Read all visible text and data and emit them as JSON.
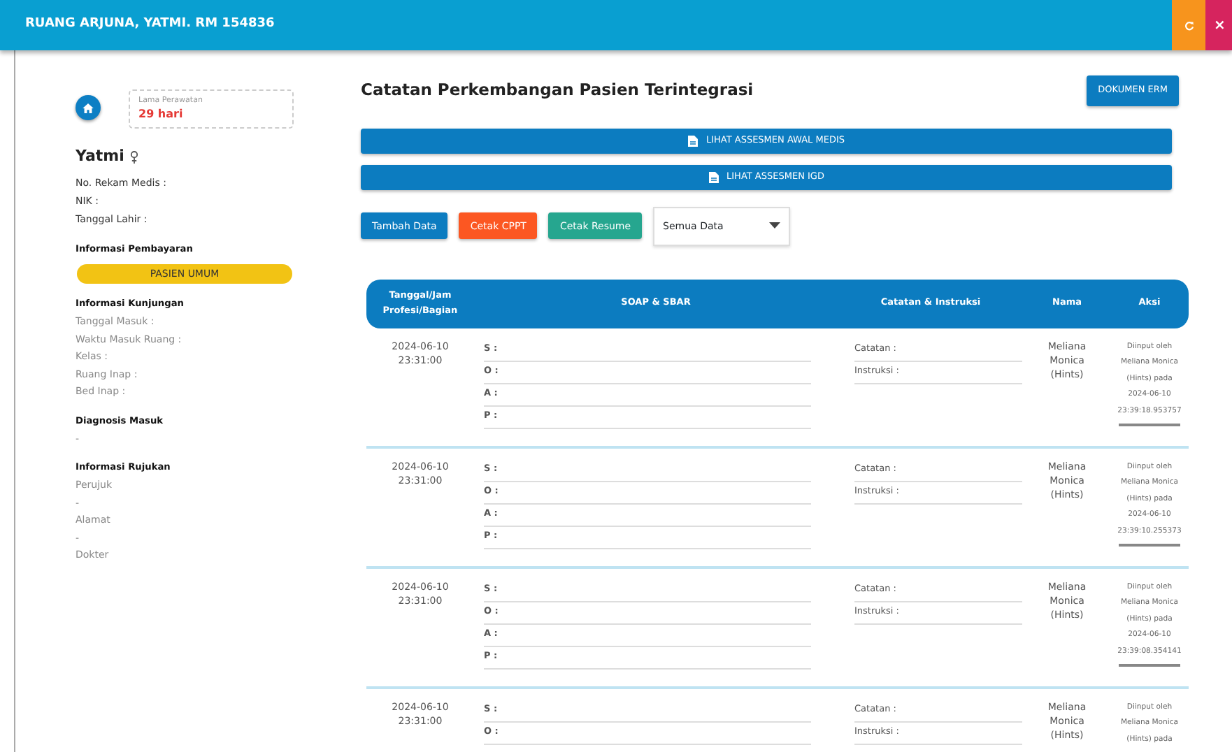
{
  "window": {
    "title": "RUANG ARJUNA, YATMI. RM 154836",
    "buttons": [
      {
        "kind": "refresh"
      },
      {
        "kind": "close",
        "label": "×"
      }
    ]
  },
  "patient": {
    "stay_label": "Lama Perawatan",
    "stay_value": "29 hari",
    "name": "Yatmi",
    "fields": [
      "No. Rekam Medis :",
      "NIK :",
      "Tanggal Lahir :"
    ],
    "sections": [
      {
        "heading": "Informasi Pembayaran",
        "badge": "PASIEN UMUM"
      },
      {
        "heading": "Informasi Kunjungan",
        "items": [
          "Tanggal Masuk :",
          "Waktu Masuk Ruang :",
          "Kelas :",
          "Ruang Inap :",
          "Bed Inap :"
        ]
      },
      {
        "heading": "Diagnosis Masuk",
        "items": [
          "-"
        ]
      },
      {
        "heading": "Informasi Rujukan",
        "items": [
          "Perujuk",
          "-",
          "Alamat",
          "-",
          "Dokter"
        ]
      }
    ]
  },
  "main": {
    "title": "Catatan Perkembangan Pasien Terintegrasi",
    "doc_button": "DOKUMEN ERM",
    "wide_buttons": [
      "LIHAT ASSESMEN AWAL MEDIS",
      "LIHAT ASSESMEN IGD"
    ],
    "actions": [
      {
        "label": "Tambah Data",
        "kind": "primary"
      },
      {
        "label": "Cetak CPPT",
        "kind": "danger"
      },
      {
        "label": "Cetak Resume",
        "kind": "success"
      }
    ],
    "filter": {
      "value": "Semua Data"
    }
  },
  "table": {
    "columns": [
      "Tanggal/Jam Profesi/Bagian",
      "SOAP & SBAR",
      "Catatan & Instruksi",
      "Nama",
      "Aksi"
    ],
    "rows": [
      {
        "date": "2024-06-10",
        "time": "23:31:00",
        "soap": [
          "S :",
          "O :",
          "A :",
          "P :"
        ],
        "notes": [
          "Catatan :",
          "Instruksi :"
        ],
        "name": "Meliana Monica (Hints)",
        "action": "Diinput oleh Meliana Monica (Hints) pada 2024-06-10 23:39:18.953757"
      },
      {
        "date": "2024-06-10",
        "time": "23:31:00",
        "soap": [
          "S :",
          "O :",
          "A :",
          "P :"
        ],
        "notes": [
          "Catatan :",
          "Instruksi :"
        ],
        "name": "Meliana Monica (Hints)",
        "action": "Diinput oleh Meliana Monica (Hints) pada 2024-06-10 23:39:10.255373"
      },
      {
        "date": "2024-06-10",
        "time": "23:31:00",
        "soap": [
          "S :",
          "O :",
          "A :",
          "P :"
        ],
        "notes": [
          "Catatan :",
          "Instruksi :"
        ],
        "name": "Meliana Monica (Hints)",
        "action": "Diinput oleh Meliana Monica (Hints) pada 2024-06-10 23:39:08.354141"
      },
      {
        "date": "2024-06-10",
        "time": "23:31:00",
        "soap": [
          "S :",
          "O :"
        ],
        "notes": [
          "Catatan :",
          "Instruksi :"
        ],
        "name": "Meliana Monica (Hints)",
        "action": "Diinput oleh Meliana Monica (Hints) pada"
      }
    ]
  }
}
